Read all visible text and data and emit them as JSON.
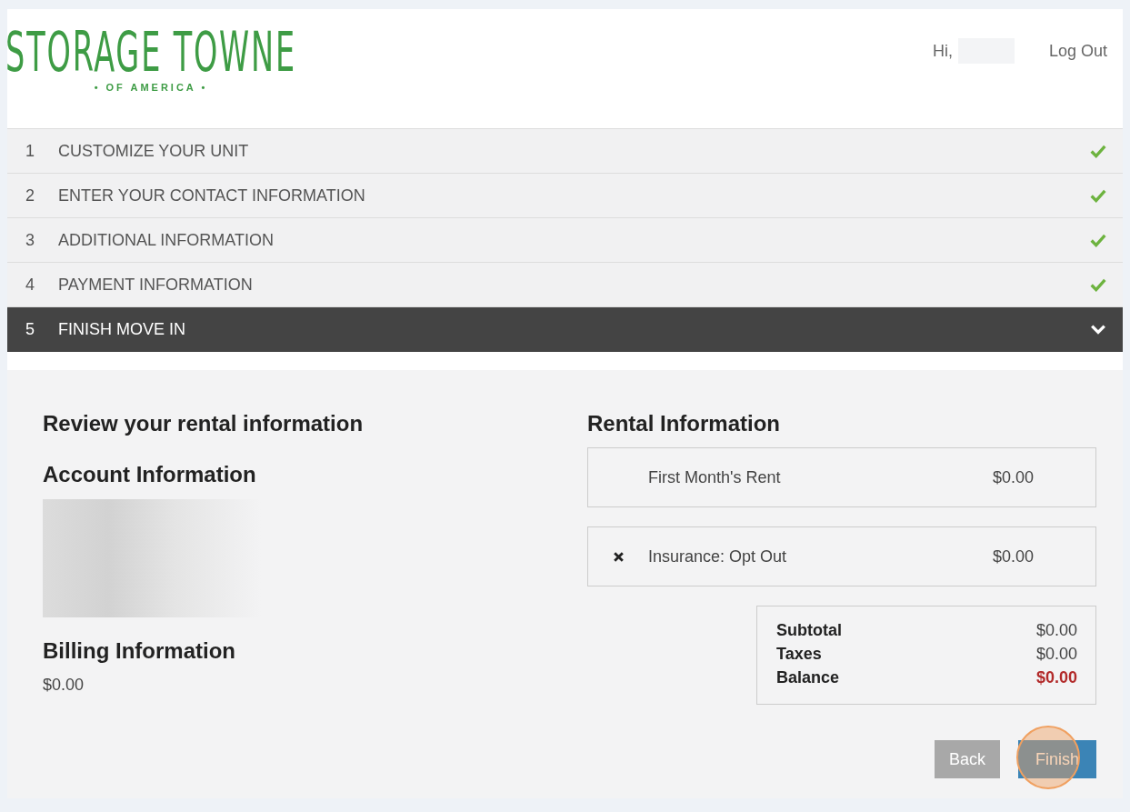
{
  "header": {
    "logo": {
      "name": "STORAGE TOWNE",
      "tagline": "• OF AMERICA •"
    },
    "greeting": "Hi,",
    "logout": "Log Out"
  },
  "steps": [
    {
      "number": "1",
      "label": "CUSTOMIZE YOUR UNIT",
      "completed": true,
      "expanded": false
    },
    {
      "number": "2",
      "label": "ENTER YOUR CONTACT INFORMATION",
      "completed": true,
      "expanded": false
    },
    {
      "number": "3",
      "label": "ADDITIONAL INFORMATION",
      "completed": true,
      "expanded": false
    },
    {
      "number": "4",
      "label": "PAYMENT INFORMATION",
      "completed": true,
      "expanded": false
    },
    {
      "number": "5",
      "label": "FINISH MOVE IN",
      "completed": false,
      "expanded": true
    }
  ],
  "review": {
    "title": "Review your rental information",
    "account_title": "Account Information",
    "billing_title": "Billing Information",
    "billing_amount": "$0.00"
  },
  "rental": {
    "title": "Rental Information",
    "items": [
      {
        "kind": "charge",
        "label": "First Month's Rent",
        "amount": "$0.00"
      },
      {
        "kind": "declined",
        "label": "Insurance: Opt Out",
        "amount": "$0.00"
      }
    ],
    "totals": [
      {
        "kind": "line",
        "label": "Subtotal",
        "amount": "$0.00"
      },
      {
        "kind": "line",
        "label": "Taxes",
        "amount": "$0.00"
      },
      {
        "kind": "due",
        "label": "Balance",
        "amount": "$0.00"
      }
    ]
  },
  "buttons": [
    {
      "kind": "back",
      "label": "Back"
    },
    {
      "kind": "primary",
      "label": "Finish",
      "clicked": true
    }
  ]
}
